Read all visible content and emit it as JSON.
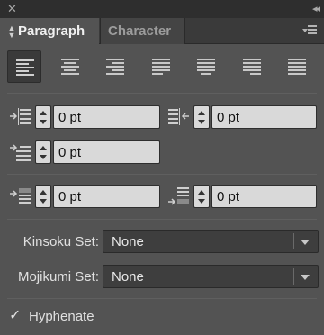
{
  "window": {
    "close_icon": "close-icon",
    "collapse_icon": "double-chevron-right-icon"
  },
  "tabs": [
    {
      "label": "Paragraph",
      "active": true
    },
    {
      "label": "Character",
      "active": false
    }
  ],
  "alignment": {
    "buttons": [
      "align-left",
      "align-center",
      "align-right",
      "justify-last-left",
      "justify-last-center",
      "justify-last-right",
      "justify-all"
    ],
    "selected": "align-left"
  },
  "indents": {
    "left_indent": "0 pt",
    "right_indent": "0 pt",
    "first_line_indent": "0 pt"
  },
  "spacing": {
    "space_before": "0 pt",
    "space_after": "0 pt"
  },
  "kinsoku": {
    "label": "Kinsoku Set:",
    "value": "None"
  },
  "mojikumi": {
    "label": "Mojikumi Set:",
    "value": "None"
  },
  "hyphenate": {
    "label": "Hyphenate",
    "checked": true
  },
  "colors": {
    "panel_bg": "#535353",
    "tab_bar_bg": "#3a3a3a",
    "field_bg": "#d9d9d9"
  }
}
